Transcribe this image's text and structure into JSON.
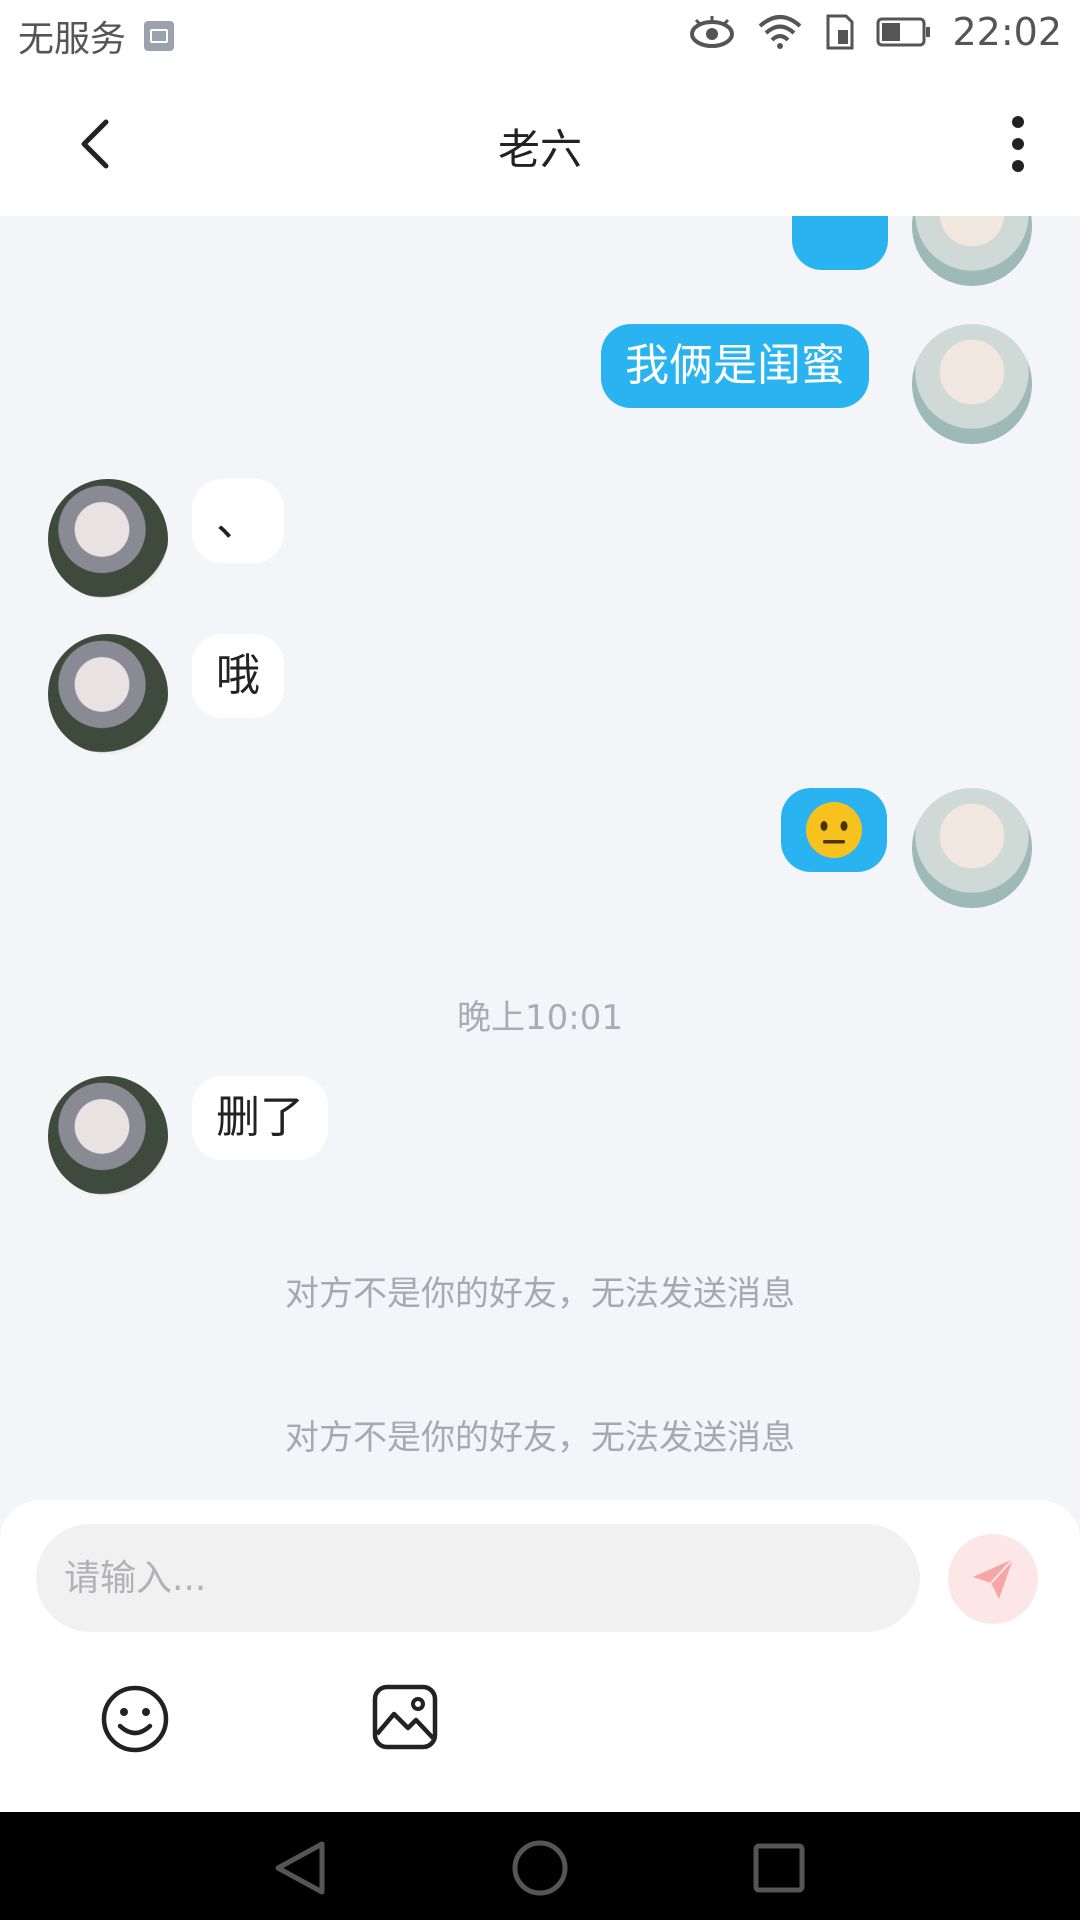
{
  "status_bar": {
    "carrier": "无服务",
    "time": "22:02",
    "icons": [
      "image-icon",
      "eye-icon",
      "wifi-icon",
      "sim-icon",
      "battery-icon"
    ]
  },
  "header": {
    "title": "老六",
    "back_icon": "chevron-left-icon",
    "more_icon": "more-vertical-icon"
  },
  "messages": [
    {
      "from": "me",
      "text": "我俩是闺蜜"
    },
    {
      "from": "other",
      "text": "、"
    },
    {
      "from": "other",
      "text": "哦"
    },
    {
      "from": "me",
      "type": "emoji",
      "emoji": "neutral-face"
    },
    {
      "type": "timestamp",
      "text": "晚上10:01"
    },
    {
      "from": "other",
      "text": "删了"
    },
    {
      "type": "system",
      "text": "对方不是你的好友，无法发送消息"
    },
    {
      "type": "system",
      "text": "对方不是你的好友，无法发送消息"
    }
  ],
  "composer": {
    "placeholder": "请输入...",
    "send_icon": "paper-plane-icon",
    "tools": [
      "smile-icon",
      "image-icon"
    ]
  },
  "colors": {
    "my_bubble": "#29b3f1",
    "background": "#f3f5f8",
    "send_button_bg": "#fde6e6",
    "send_icon": "#f7a6a6"
  }
}
